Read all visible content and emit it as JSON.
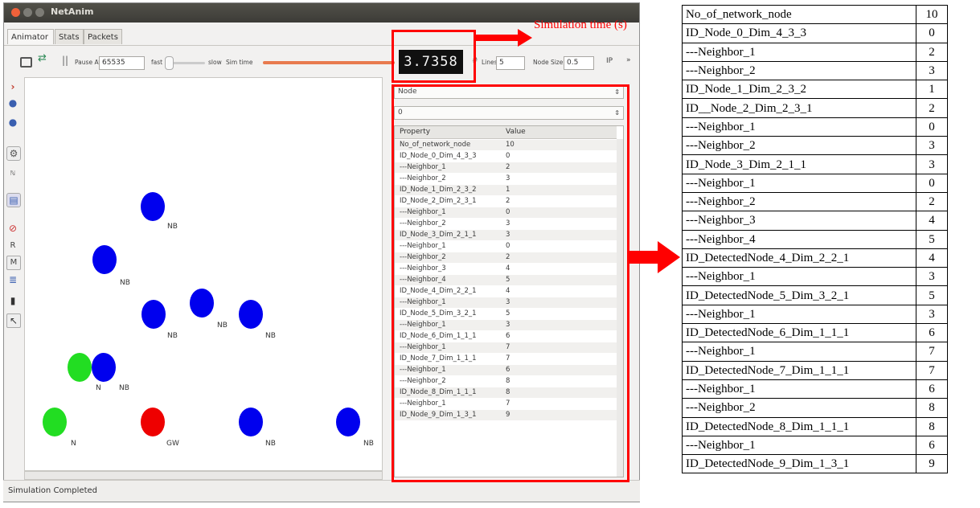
{
  "window": {
    "title": "NetAnim",
    "tabs": [
      "Animator",
      "Stats",
      "Packets"
    ]
  },
  "toolbar": {
    "pause_at_label": "Pause At",
    "pause_at_value": "65535",
    "fast_label": "fast",
    "slow_label": "slow",
    "sim_time_label": "Sim time",
    "sim_time_display": "3.7358",
    "lines_label": "Lines",
    "lines_value": "5",
    "node_size_label": "Node Size",
    "node_size_value": "0.5",
    "ip_label": "IP",
    "more_label": "»"
  },
  "sidebar_letters": {
    "r": "R",
    "m": "M"
  },
  "nodes": [
    {
      "label": "NB",
      "color": "#0000ee"
    },
    {
      "label": "NB",
      "color": "#0000ee"
    },
    {
      "label": "NB",
      "color": "#0000ee"
    },
    {
      "label": "NB",
      "color": "#0000ee"
    },
    {
      "label": "NB",
      "color": "#0000ee"
    },
    {
      "label": "N",
      "color": "#22dd22"
    },
    {
      "label": "NB",
      "color": "#0000ee"
    },
    {
      "label": "N",
      "color": "#22dd22"
    },
    {
      "label": "GW",
      "color": "#ee0000"
    },
    {
      "label": "NB",
      "color": "#0000ee"
    },
    {
      "label": "NB",
      "color": "#0000ee"
    }
  ],
  "panel": {
    "type_select": "Node",
    "id_select": "0",
    "col_property": "Property",
    "col_value": "Value",
    "rows": [
      [
        "No_of_network_node",
        "10"
      ],
      [
        "ID_Node_0_Dim_4_3_3",
        "0"
      ],
      [
        "---Neighbor_1",
        "2"
      ],
      [
        "---Neighbor_2",
        "3"
      ],
      [
        "ID_Node_1_Dim_2_3_2",
        "1"
      ],
      [
        "ID_Node_2_Dim_2_3_1",
        "2"
      ],
      [
        "---Neighbor_1",
        "0"
      ],
      [
        "---Neighbor_2",
        "3"
      ],
      [
        "ID_Node_3_Dim_2_1_1",
        "3"
      ],
      [
        "---Neighbor_1",
        "0"
      ],
      [
        "---Neighbor_2",
        "2"
      ],
      [
        "---Neighbor_3",
        "4"
      ],
      [
        "---Neighbor_4",
        "5"
      ],
      [
        "ID_Node_4_Dim_2_2_1",
        "4"
      ],
      [
        "---Neighbor_1",
        "3"
      ],
      [
        "ID_Node_5_Dim_3_2_1",
        "5"
      ],
      [
        "---Neighbor_1",
        "3"
      ],
      [
        "ID_Node_6_Dim_1_1_1",
        "6"
      ],
      [
        "---Neighbor_1",
        "7"
      ],
      [
        "ID_Node_7_Dim_1_1_1",
        "7"
      ],
      [
        "---Neighbor_1",
        "6"
      ],
      [
        "---Neighbor_2",
        "8"
      ],
      [
        "ID_Node_8_Dim_1_1_1",
        "8"
      ],
      [
        "---Neighbor_1",
        "7"
      ],
      [
        "ID_Node_9_Dim_1_3_1",
        "9"
      ]
    ]
  },
  "status": {
    "text": "Simulation Completed"
  },
  "annotation": {
    "sim_time_label": "Simulation time (s)",
    "highlight_color": "#ff0000"
  },
  "right_table": [
    [
      "No_of_network_node",
      "10"
    ],
    [
      "ID_Node_0_Dim_4_3_3",
      "0"
    ],
    [
      "---Neighbor_1",
      "2"
    ],
    [
      "---Neighbor_2",
      "3"
    ],
    [
      "ID_Node_1_Dim_2_3_2",
      "1"
    ],
    [
      "ID__Node_2_Dim_2_3_1",
      "2"
    ],
    [
      "---Neighbor_1",
      "0"
    ],
    [
      "---Neighbor_2",
      "3"
    ],
    [
      "ID_Node_3_Dim_2_1_1",
      "3"
    ],
    [
      "---Neighbor_1",
      "0"
    ],
    [
      "---Neighbor_2",
      "2"
    ],
    [
      "---Neighbor_3",
      "4"
    ],
    [
      "---Neighbor_4",
      "5"
    ],
    [
      "ID_DetectedNode_4_Dim_2_2_1",
      "4"
    ],
    [
      "---Neighbor_1",
      "3"
    ],
    [
      "ID_DetectedNode_5_Dim_3_2_1",
      "5"
    ],
    [
      "---Neighbor_1",
      "3"
    ],
    [
      "ID_DetectedNode_6_Dim_1_1_1",
      "6"
    ],
    [
      "---Neighbor_1",
      "7"
    ],
    [
      "ID_DetectedNode_7_Dim_1_1_1",
      "7"
    ],
    [
      "---Neighbor_1",
      "6"
    ],
    [
      "---Neighbor_2",
      "8"
    ],
    [
      "ID_DetectedNode_8_Dim_1_1_1",
      "8"
    ],
    [
      "---Neighbor_1",
      "6"
    ],
    [
      "ID_DetectedNode_9_Dim_1_3_1",
      "9"
    ]
  ]
}
